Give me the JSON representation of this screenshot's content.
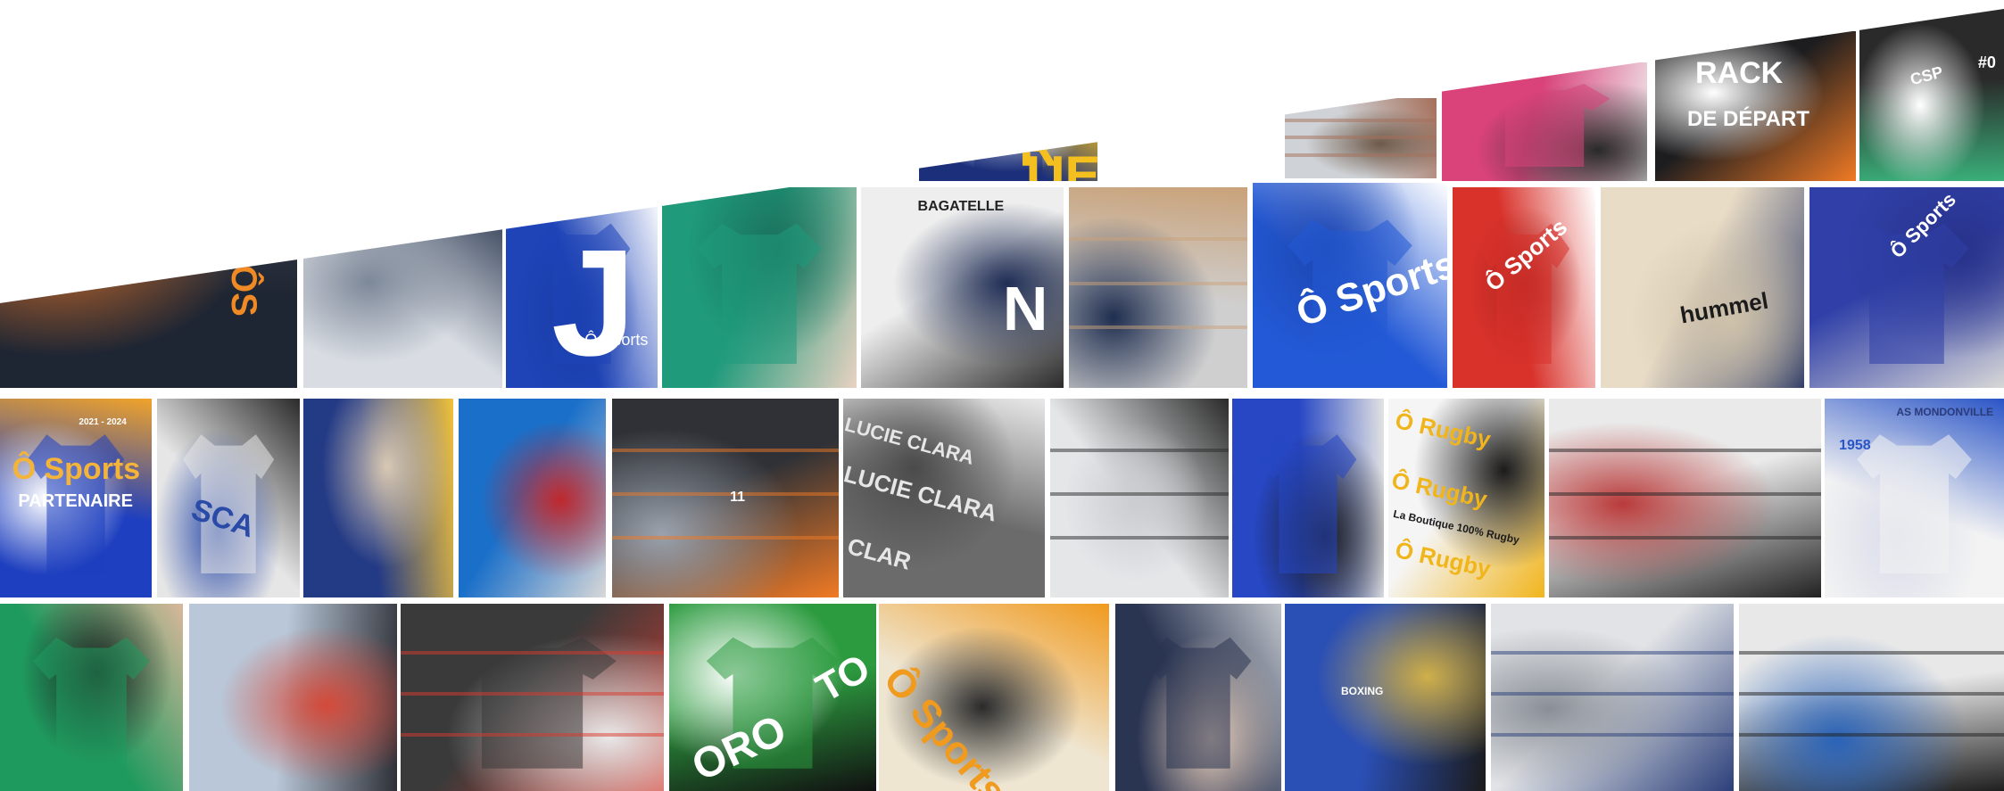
{
  "background_color": "#ffffff",
  "photos": [
    {
      "name": "photo-showroom-crowd",
      "palette": [
        "#1f2633",
        "#3a3f4c",
        "#c86a2a"
      ],
      "texts": [
        {
          "t": "ÔS",
          "name": "banner-osports-partial",
          "color": "#f08a24"
        }
      ]
    },
    {
      "name": "photo-conveyor-dryer",
      "palette": [
        "#d9dde3",
        "#1d2b45",
        "#7c8798"
      ],
      "texts": []
    },
    {
      "name": "photo-blue-jersey-number",
      "palette": [
        "#1e44b8",
        "#ffffff",
        "#1a3ca6"
      ],
      "texts": [
        {
          "t": "J",
          "name": "jersey-letter",
          "color": "#ffffff"
        },
        {
          "t": "Ô Sports",
          "name": "jersey-brand",
          "color": "#ffffff"
        }
      ]
    },
    {
      "name": "photo-green-jersey-badge",
      "palette": [
        "#1f9a7b",
        "#e9d2c2",
        "#1a6f5a"
      ],
      "texts": []
    },
    {
      "name": "photo-bagatelle-board",
      "palette": [
        "#eeeeee",
        "#2b2b2b",
        "#1f2d55"
      ],
      "texts": [
        {
          "t": "BAGATELLE",
          "name": "board-title",
          "color": "#222222"
        },
        {
          "t": "N",
          "name": "shirt-letter",
          "color": "#ffffff"
        }
      ]
    },
    {
      "name": "photo-warehouse-boxes",
      "palette": [
        "#cfcfcf",
        "#c9a279",
        "#1f2e4f"
      ],
      "texts": []
    },
    {
      "name": "photo-blue-jersey-osports",
      "palette": [
        "#2359d6",
        "#ffffff",
        "#1c46b0"
      ],
      "texts": [
        {
          "t": "Ô Sports",
          "name": "jersey-brand-large",
          "color": "#ffffff"
        }
      ]
    },
    {
      "name": "photo-red-shirt-osports",
      "palette": [
        "#d8322b",
        "#ffffff",
        "#b02520"
      ],
      "texts": [
        {
          "t": "Ô Sports",
          "name": "red-shirt-brand",
          "color": "#ffffff"
        }
      ]
    },
    {
      "name": "photo-hummel-hangers",
      "palette": [
        "#e9dcc6",
        "#2c3a66",
        "#cfc2aa"
      ],
      "texts": [
        {
          "t": "hummel",
          "name": "hanger-brand",
          "color": "#1b1b1b"
        }
      ]
    },
    {
      "name": "photo-heat-press-blue-shirt",
      "palette": [
        "#3040a8",
        "#d7d7d7",
        "#28328a"
      ],
      "texts": [
        {
          "t": "Ô Sports",
          "name": "pressed-shirt-brand",
          "color": "#ffffff"
        }
      ]
    },
    {
      "name": "photo-partner-jersey",
      "palette": [
        "#1e3fbf",
        "#f0a32a",
        "#ffffff"
      ],
      "texts": [
        {
          "t": "2021 - 2024",
          "name": "jersey-years",
          "color": "#ffffff"
        },
        {
          "t": "Ô Sports",
          "name": "partner-brand",
          "color": "#f4b43a"
        },
        {
          "t": "PARTENAIRE",
          "name": "partner-label",
          "color": "#ffffff"
        }
      ]
    },
    {
      "name": "photo-printing-white-shirt",
      "palette": [
        "#e6e6e6",
        "#2b2b2b",
        "#2a4aa8"
      ],
      "texts": [
        {
          "t": "SCA",
          "name": "white-shirt-print",
          "color": "#2a4aa8"
        }
      ]
    },
    {
      "name": "photo-cap-embroidery",
      "palette": [
        "#233a85",
        "#f1c23b",
        "#d8c8b4"
      ],
      "texts": []
    },
    {
      "name": "photo-blue-hummel-jacket",
      "palette": [
        "#1a6fc9",
        "#d8d8d8",
        "#c0282d"
      ],
      "texts": []
    },
    {
      "name": "photo-storefront-vans",
      "palette": [
        "#2f3136",
        "#f07a25",
        "#9aa2ad"
      ],
      "texts": [
        {
          "t": "11",
          "name": "store-number",
          "color": "#ffffff"
        }
      ]
    },
    {
      "name": "photo-name-transfers",
      "palette": [
        "#6b6b6b",
        "#e9e9e9",
        "#4a4a4a"
      ],
      "texts": [
        {
          "t": "LUCIE CLARA",
          "name": "transfer-name-1",
          "color": "#e6e6e6"
        },
        {
          "t": "LUCIE CLARA",
          "name": "transfer-name-2",
          "color": "#e6e6e6"
        },
        {
          "t": "CLAR",
          "name": "transfer-name-3",
          "color": "#e6e6e6"
        }
      ]
    },
    {
      "name": "photo-workshop-tables",
      "palette": [
        "#e4e6e8",
        "#2a2a2a",
        "#c9ccd0"
      ],
      "texts": []
    },
    {
      "name": "photo-heat-press-blue-tee",
      "palette": [
        "#2747c4",
        "#e2e2e2",
        "#1a1a1a"
      ],
      "texts": []
    },
    {
      "name": "photo-rugby-transfers",
      "palette": [
        "#f5f5f5",
        "#f1b51c",
        "#1b1b1b"
      ],
      "texts": [
        {
          "t": "Ô Rugby",
          "name": "rugby-transfer-1",
          "color": "#f1b51c"
        },
        {
          "t": "Ô Rugby",
          "name": "rugby-transfer-2",
          "color": "#f1b51c"
        },
        {
          "t": "Ô Rugby",
          "name": "rugby-transfer-3",
          "color": "#f1b51c"
        },
        {
          "t": "La Boutique 100% Rugby",
          "name": "rugby-tagline",
          "color": "#1b1b1b"
        }
      ]
    },
    {
      "name": "photo-shop-interior-table",
      "palette": [
        "#eaeaea",
        "#222222",
        "#b93a3a"
      ],
      "texts": []
    },
    {
      "name": "photo-as-mondonville-shirt",
      "palette": [
        "#f3f3f3",
        "#2a55c7",
        "#d9dcea"
      ],
      "texts": [
        {
          "t": "AS MONDONVILLE",
          "name": "club-name",
          "color": "#2a3a7a"
        },
        {
          "t": "1958",
          "name": "club-year",
          "color": "#2a55c7"
        }
      ]
    },
    {
      "name": "photo-man-green-jersey",
      "palette": [
        "#1f9a5e",
        "#d9b79a",
        "#1f1f1f"
      ],
      "texts": []
    },
    {
      "name": "photo-outdoor-event-crowd",
      "palette": [
        "#b9c7d8",
        "#2d2f36",
        "#d44a3a"
      ],
      "texts": []
    },
    {
      "name": "photo-shop-wall-shirts",
      "palette": [
        "#3a3a3a",
        "#d9392e",
        "#e9e9e9"
      ],
      "texts": []
    },
    {
      "name": "photo-green-shirt-print",
      "palette": [
        "#2c9b3f",
        "#111111",
        "#ffffff"
      ],
      "texts": [
        {
          "t": "TO",
          "name": "green-shirt-print-a",
          "color": "#ffffff"
        },
        {
          "t": "ORO",
          "name": "green-shirt-print-b",
          "color": "#ffffff"
        }
      ]
    },
    {
      "name": "photo-weeding-osports",
      "palette": [
        "#efe6d2",
        "#f09a1e",
        "#2a2a2a"
      ],
      "texts": [
        {
          "t": "Ô Sports",
          "name": "weeding-brand",
          "color": "#f09a1e"
        }
      ]
    },
    {
      "name": "photo-navy-shirt-badge",
      "palette": [
        "#2a3552",
        "#bfc3c9",
        "#e9d0bc"
      ],
      "texts": []
    },
    {
      "name": "photo-blue-cap-press",
      "palette": [
        "#2a4fb5",
        "#1b1b1b",
        "#d0b04a"
      ],
      "texts": [
        {
          "t": "BOXING",
          "name": "cap-print",
          "color": "#ffffff"
        }
      ]
    },
    {
      "name": "photo-workshop-shelves",
      "palette": [
        "#e1e3e6",
        "#2b3f7a",
        "#8a8f97"
      ],
      "texts": []
    },
    {
      "name": "photo-store-aisle",
      "palette": [
        "#e8e8e8",
        "#1f1f1f",
        "#2a63b8"
      ],
      "texts": []
    },
    {
      "name": "photo-jerseys-sublimated",
      "palette": [
        "#1b2f7a",
        "#f3c020",
        "#ffffff"
      ],
      "texts": [
        {
          "t": "R",
          "name": "jersey-print-a",
          "color": "#f3c020"
        },
        {
          "t": "UE",
          "name": "jersey-print-b",
          "color": "#f3c020"
        }
      ]
    },
    {
      "name": "photo-warehouse-pallets",
      "palette": [
        "#cfd2d6",
        "#a56f5a",
        "#6e5a4a"
      ],
      "texts": []
    },
    {
      "name": "photo-pink-white-jerseys",
      "palette": [
        "#d9437a",
        "#f1f1f1",
        "#2a2a2a"
      ],
      "texts": []
    },
    {
      "name": "photo-rack-depart-sign",
      "palette": [
        "#1d1d1f",
        "#f07a25",
        "#ffffff"
      ],
      "texts": [
        {
          "t": "RACK",
          "name": "rack-sign-title",
          "color": "#ffffff"
        },
        {
          "t": "DE DÉPART",
          "name": "rack-sign-subtitle",
          "color": "#ffffff"
        }
      ]
    },
    {
      "name": "photo-csp-bag",
      "palette": [
        "#2a2a2a",
        "#3ab07a",
        "#ffffff"
      ],
      "texts": [
        {
          "t": "CSP",
          "name": "bag-badge",
          "color": "#ffffff"
        },
        {
          "t": "#0",
          "name": "bag-number",
          "color": "#ffffff"
        }
      ]
    }
  ]
}
